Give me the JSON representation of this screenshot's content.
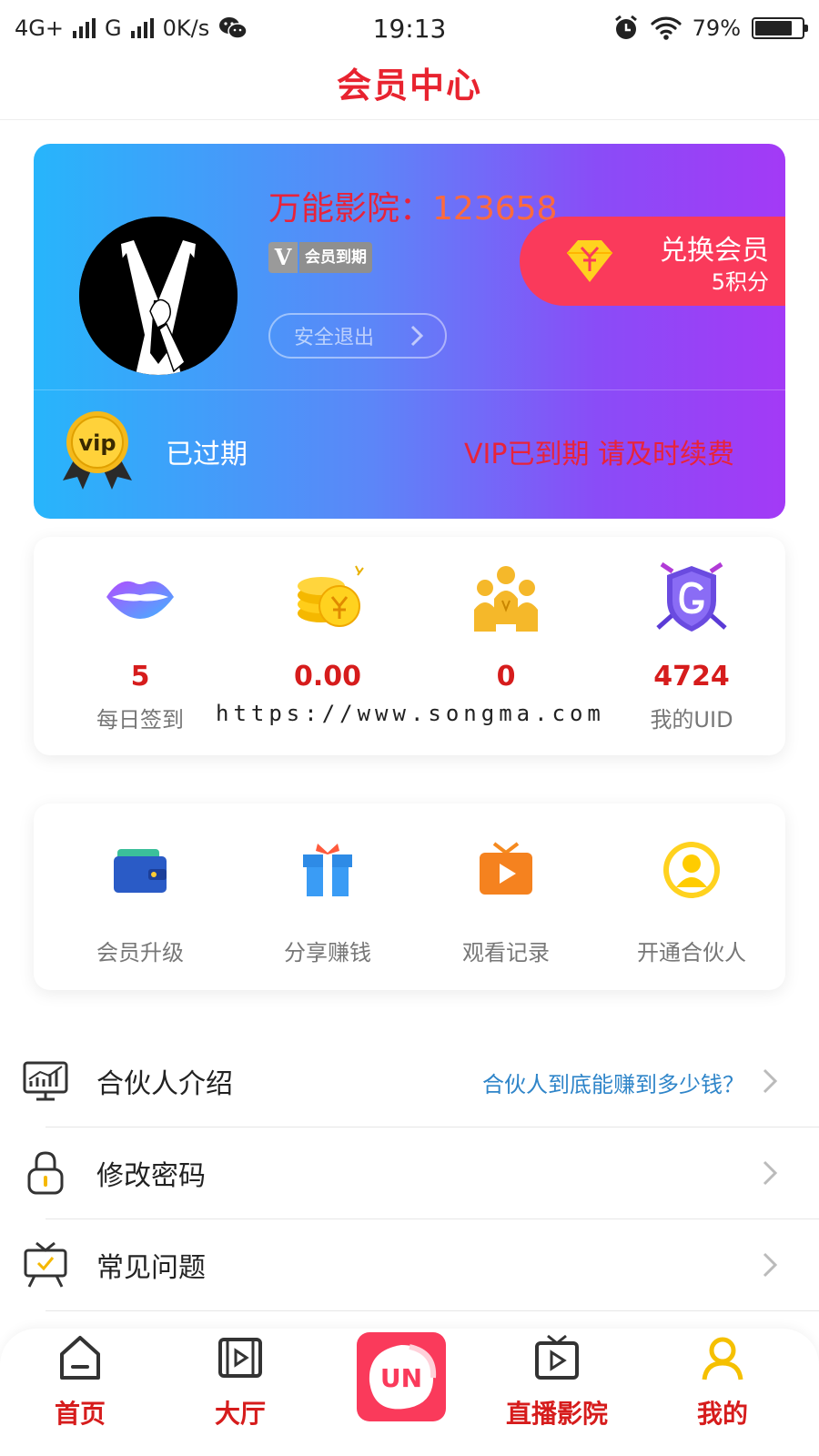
{
  "status_bar": {
    "network1": "4G+",
    "network2": "G",
    "speed": "0K/s",
    "time": "19:13",
    "battery": "79%",
    "battery_level": 0.79
  },
  "header": {
    "title": "会员中心"
  },
  "member_card": {
    "name_label": "万能影院：",
    "uid_partial": "123658",
    "vip_badge_letter": "V",
    "vip_badge_text": "会员到期",
    "logout_label": "安全退出",
    "exchange_label": "兑换会员",
    "exchange_points": "5积分",
    "medal_text": "vip",
    "status": "已过期",
    "renew_notice": "VIP已到期 请及时续费"
  },
  "stats": [
    {
      "value": "5",
      "label": "每日签到",
      "icon": "lips-icon"
    },
    {
      "value": "0.00",
      "label": "",
      "icon": "coins-icon"
    },
    {
      "value": "0",
      "label": "",
      "icon": "team-icon"
    },
    {
      "value": "4724",
      "label": "我的UID",
      "icon": "shield-g-icon"
    }
  ],
  "watermark": "https://www.songma.com",
  "actions": [
    {
      "label": "会员升级",
      "icon": "wallet-icon"
    },
    {
      "label": "分享赚钱",
      "icon": "gift-icon"
    },
    {
      "label": "观看记录",
      "icon": "tv-play-icon"
    },
    {
      "label": "开通合伙人",
      "icon": "user-circle-icon"
    }
  ],
  "list": [
    {
      "label": "合伙人介绍",
      "hint": "合伙人到底能赚到多少钱？",
      "icon": "chart-monitor-icon"
    },
    {
      "label": "修改密码",
      "hint": "",
      "icon": "lock-icon"
    },
    {
      "label": "常见问题",
      "hint": "",
      "icon": "easel-icon"
    }
  ],
  "tabbar": [
    {
      "label": "首页",
      "icon": "home-icon"
    },
    {
      "label": "大厅",
      "icon": "film-icon"
    },
    {
      "label": "",
      "icon": "app-logo-icon"
    },
    {
      "label": "直播影院",
      "icon": "tv-icon"
    },
    {
      "label": "我的",
      "icon": "user-icon"
    }
  ],
  "colors": {
    "brand_red": "#e8232f",
    "card_gradient_start": "#27b5fb",
    "card_gradient_end": "#a33af6",
    "exchange_bg": "#fa3a5b",
    "stat_value": "#d61c1c",
    "hint_blue": "#2f85c9"
  }
}
